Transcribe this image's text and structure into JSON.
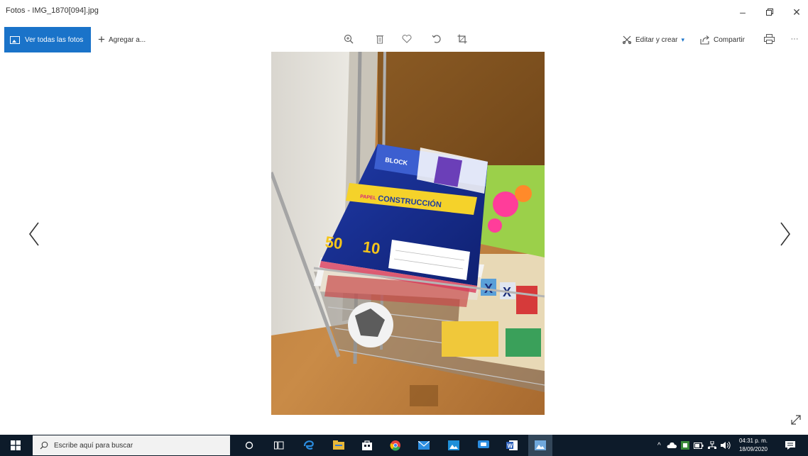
{
  "window": {
    "title": "Fotos - IMG_1870[094].jpg",
    "minimize_glyph": "–",
    "maximize_glyph": "🗗",
    "close_glyph": "✕"
  },
  "toolbar": {
    "view_all_label": "Ver todas las fotos",
    "add_to_label": "Agregar a...",
    "edit_create_label": "Editar y crear",
    "share_label": "Compartir",
    "more_glyph": "···",
    "icons": [
      "zoom-icon",
      "delete-icon",
      "favorite-icon",
      "rotate-icon",
      "crop-icon",
      "print-icon"
    ]
  },
  "photo": {
    "book_brand": "BLOCK",
    "book_title": "CONSTRUCCIÓN",
    "book_prefix": "PAPEL",
    "sheets_count": "50",
    "colors_count": "10"
  },
  "taskbar": {
    "search_placeholder": "Escribe aquí para buscar",
    "time": "04:31 p. m.",
    "date": "18/09/2020"
  },
  "colors": {
    "accent": "#1a73c9",
    "taskbar": "#0d1b2a"
  }
}
